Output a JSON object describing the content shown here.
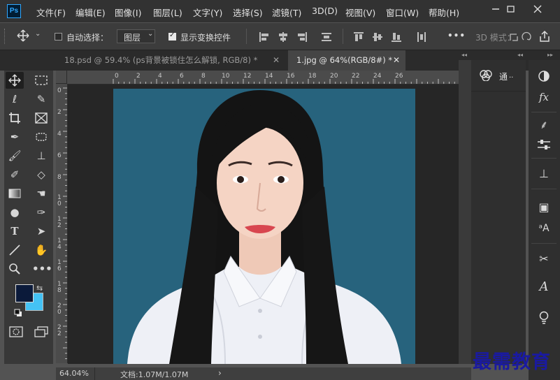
{
  "menubar": {
    "logo": "Ps",
    "items": [
      "文件(F)",
      "编辑(E)",
      "图像(I)",
      "图层(L)",
      "文字(Y)",
      "选择(S)",
      "滤镜(T)",
      "3D(D)",
      "视图(V)",
      "窗口(W)",
      "帮助(H)"
    ],
    "window_controls": [
      "minimize-icon",
      "restore-icon",
      "close-icon"
    ]
  },
  "options": {
    "auto_select_label": "自动选择：",
    "auto_select_checked": false,
    "layer_select_value": "图层",
    "show_transform_label": "显示变换控件",
    "show_transform_checked": true,
    "more_label": "•••",
    "mode_3d_label": "3D 模式："
  },
  "tabs": [
    {
      "label": "18.psd @ 59.4% (ps背景被锁住怎么解锁, RGB/8) *",
      "active": false
    },
    {
      "label": "1.jpg @ 64%(RGB/8#) *",
      "active": true
    }
  ],
  "ruler": {
    "h_ticks": [
      "0",
      "2",
      "4",
      "6",
      "8",
      "10",
      "12",
      "14",
      "16",
      "18",
      "20",
      "22",
      "24",
      "26"
    ],
    "v_ticks": [
      "0",
      "2",
      "4",
      "6",
      "8",
      "1\n0",
      "1\n2",
      "1\n4",
      "1\n6",
      "1\n8",
      "2\n0",
      "2\n2"
    ]
  },
  "tools": [
    [
      "move-tool-icon",
      "marquee-tool-icon"
    ],
    [
      "lasso-tool-icon",
      "quick-select-tool-icon"
    ],
    [
      "crop-tool-icon",
      "frame-tool-icon"
    ],
    [
      "eyedropper-tool-icon",
      "spot-healing-tool-icon"
    ],
    [
      "brush-tool-icon",
      "stamp-tool-icon"
    ],
    [
      "history-brush-tool-icon",
      "eraser-tool-icon"
    ],
    [
      "gradient-tool-icon",
      "smudge-tool-icon"
    ],
    [
      "dodge-tool-icon",
      "pen-tool-icon"
    ],
    [
      "type-tool-icon",
      "path-select-tool-icon"
    ],
    [
      "line-tool-icon",
      "hand-tool-icon"
    ],
    [
      "zoom-tool-icon",
      "more-tools-icon"
    ]
  ],
  "colors": {
    "foreground": "#0b1a3a",
    "background": "#44c2f5",
    "canvas": "#27637d",
    "accent": "#31a8ff"
  },
  "panel": {
    "channels_label": "通"
  },
  "right_tools": [
    "adjust-icon",
    "fx-icon",
    "brush-settings-icon",
    "properties-icon",
    "clone-source-icon",
    "glyphs-icon",
    "character-style-icon",
    "paths-icon",
    "character-icon",
    "lightbulb-icon"
  ],
  "status": {
    "zoom": "64.04%",
    "doc_info": "文档:1.07M/1.07M"
  },
  "watermark": "最需教育"
}
